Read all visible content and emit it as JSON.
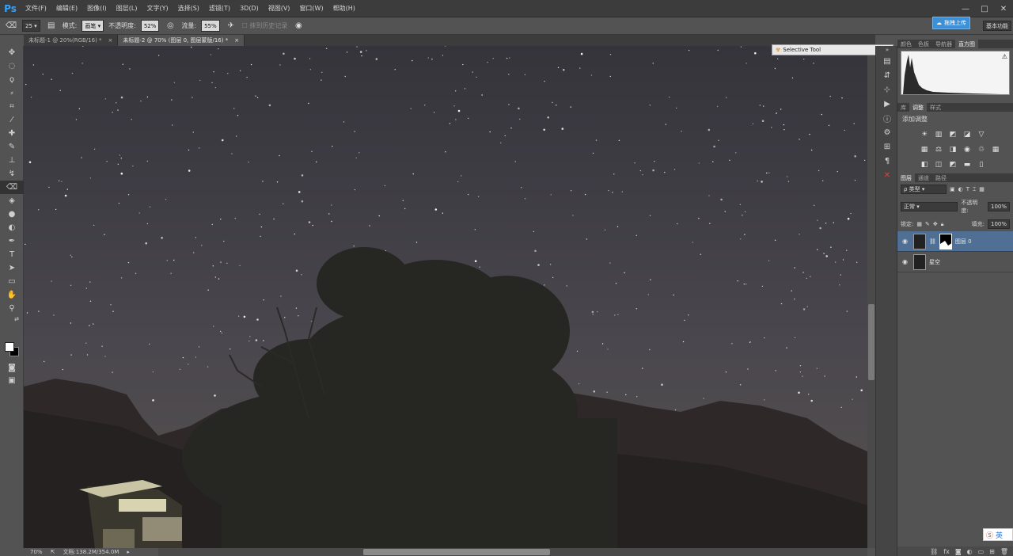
{
  "app": {
    "logo": "Ps"
  },
  "menu": [
    "文件(F)",
    "编辑(E)",
    "图像(I)",
    "图层(L)",
    "文字(Y)",
    "选择(S)",
    "滤镜(T)",
    "3D(D)",
    "视图(V)",
    "窗口(W)",
    "帮助(H)"
  ],
  "window_controls": {
    "minimize": "—",
    "maximize": "□",
    "close": "✕"
  },
  "options": {
    "brush_size": "25",
    "mode_label": "模式:",
    "mode_value": "画笔",
    "opacity_label": "不透明度:",
    "opacity_value": "52%",
    "flow_label": "流量:",
    "flow_value": "55%",
    "history_label": "抹到历史记录"
  },
  "upload_button": "拖拽上传",
  "workspace": "基本功能",
  "tabs": [
    {
      "label": "未标题-1 @ 20%(RGB/16) *",
      "close": "×"
    },
    {
      "label": "未标题-2 @ 70% (图层 0, 图层蒙版/16) *",
      "close": "×"
    }
  ],
  "status": {
    "zoom": "70%",
    "doc": "文档:138.2M/354.0M"
  },
  "float_panel": {
    "title": "Selective Tool"
  },
  "panel_tabs_top": [
    "颜色",
    "色板",
    "导航器",
    "直方图"
  ],
  "panel_tabs_mid": [
    "库",
    "调整",
    "样式"
  ],
  "adjustments_title": "添加调整",
  "panel_tabs_layers": [
    "图层",
    "通道",
    "路径"
  ],
  "layers": {
    "filter_label": "ρ 类型",
    "blend_mode": "正常",
    "opacity_label": "不透明度:",
    "opacity_value": "100%",
    "lock_label": "锁定:",
    "fill_label": "填充:",
    "fill_value": "100%",
    "items": [
      {
        "name": "图层 0",
        "active": true
      },
      {
        "name": "星空",
        "active": false
      }
    ]
  },
  "ime": {
    "label": "英"
  }
}
